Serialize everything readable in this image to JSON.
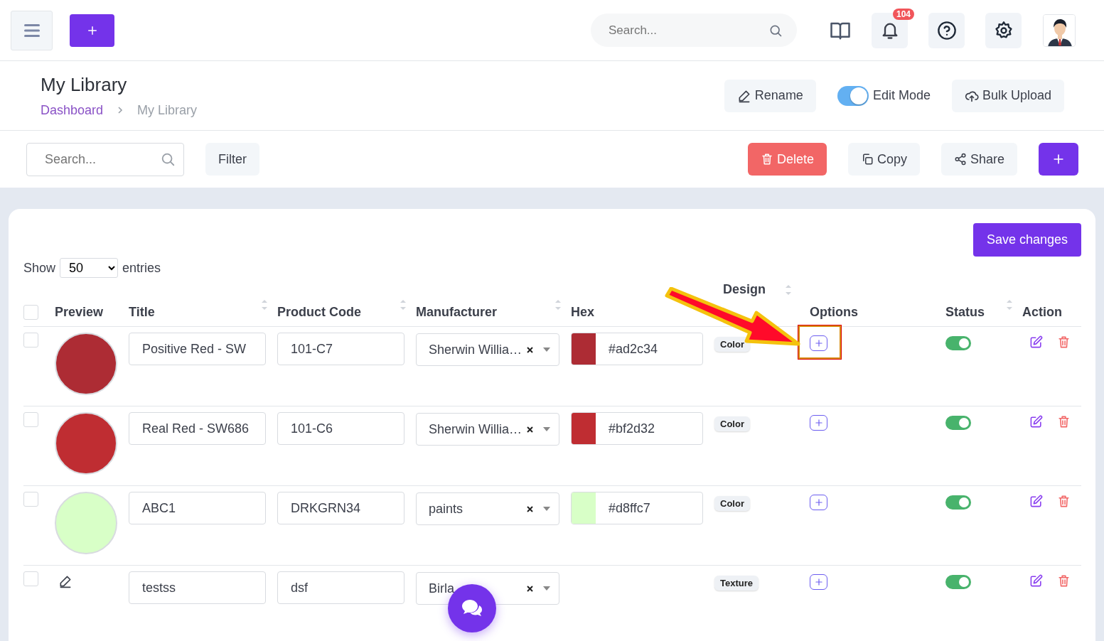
{
  "topbar": {
    "search": {
      "placeholder": "Search..."
    },
    "notifications": {
      "count": "104"
    }
  },
  "page": {
    "title": "My Library",
    "breadcrumb": [
      "Dashboard",
      "My Library"
    ],
    "actions": [
      {
        "kind": "rename",
        "label": "Rename"
      },
      {
        "kind": "toggle",
        "label": "Edit Mode",
        "on": true
      },
      {
        "kind": "upload",
        "label": "Bulk Upload"
      }
    ]
  },
  "toolbar": {
    "search": {
      "placeholder": "Search..."
    },
    "filter": "Filter",
    "buttons": [
      {
        "kind": "delete",
        "label": "Delete"
      },
      {
        "kind": "copy",
        "label": "Copy"
      },
      {
        "kind": "share",
        "label": "Share"
      },
      {
        "kind": "add"
      }
    ]
  },
  "table": {
    "save": "Save changes",
    "show": {
      "before": "Show",
      "value": "50",
      "after": "entries"
    },
    "select_all": {
      "checked": false
    },
    "columns": [
      {
        "label": "Preview",
        "sortable": false
      },
      {
        "label": "Title",
        "sortable": true
      },
      {
        "label": "Product Code",
        "sortable": true
      },
      {
        "label": "Manufacturer",
        "sortable": true
      },
      {
        "label": "Hex",
        "sortable": false
      },
      {
        "label": "Design",
        "sortable": true
      },
      {
        "label": "Options",
        "sortable": false
      },
      {
        "label": "Status",
        "sortable": true
      },
      {
        "label": "Action",
        "sortable": false
      }
    ],
    "rows": [
      {
        "checked": false,
        "preview": {
          "kind": "color",
          "color": "#ad2c34"
        },
        "title": "Positive Red - SW",
        "code": "101-C7",
        "manufacturer": "Sherwin Willia…",
        "hex": {
          "value": "#ad2c34",
          "color": "#ad2c34"
        },
        "design_type": "Color",
        "options_highlighted": true,
        "status_on": true
      },
      {
        "checked": false,
        "preview": {
          "kind": "color",
          "color": "#bf2d32"
        },
        "title": "Real Red - SW686",
        "code": "101-C6",
        "manufacturer": "Sherwin Willia…",
        "hex": {
          "value": "#bf2d32",
          "color": "#bf2d32"
        },
        "design_type": "Color",
        "options_highlighted": false,
        "status_on": true
      },
      {
        "checked": false,
        "preview": {
          "kind": "color",
          "color": "#d8ffc7"
        },
        "title": "ABC1",
        "code": "DRKGRN34",
        "manufacturer": "paints",
        "hex": {
          "value": "#d8ffc7",
          "color": "#d8ffc7"
        },
        "design_type": "Color",
        "options_highlighted": false,
        "status_on": true
      },
      {
        "checked": false,
        "preview": {
          "kind": "texture"
        },
        "title": "testss",
        "code": "dsf",
        "manufacturer": "Birla",
        "design_type": "Texture",
        "options_highlighted": false,
        "status_on": true
      }
    ]
  }
}
